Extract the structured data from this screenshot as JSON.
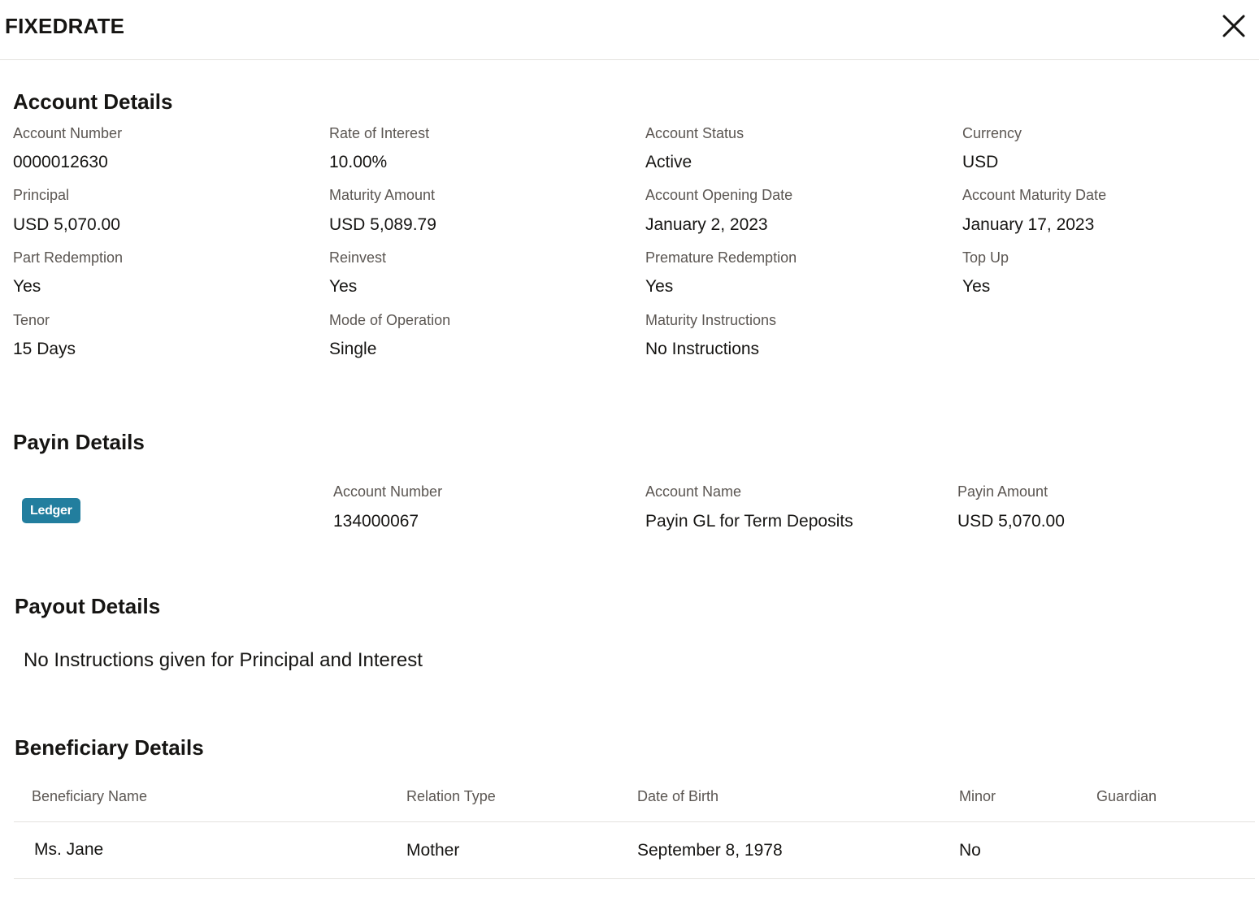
{
  "dialog": {
    "title": "FIXEDRATE"
  },
  "icons": {
    "close": "close-icon"
  },
  "account_details": {
    "title": "Account Details",
    "fields": [
      {
        "label": "Account Number",
        "value": "0000012630"
      },
      {
        "label": "Rate of Interest",
        "value": "10.00%"
      },
      {
        "label": "Account Status",
        "value": "Active"
      },
      {
        "label": "Currency",
        "value": "USD"
      },
      {
        "label": "Principal",
        "value": "USD 5,070.00"
      },
      {
        "label": "Maturity Amount",
        "value": "USD 5,089.79"
      },
      {
        "label": "Account Opening Date",
        "value": "January 2, 2023"
      },
      {
        "label": "Account Maturity Date",
        "value": "January 17, 2023"
      },
      {
        "label": "Part Redemption",
        "value": "Yes"
      },
      {
        "label": "Reinvest",
        "value": "Yes"
      },
      {
        "label": "Premature Redemption",
        "value": "Yes"
      },
      {
        "label": "Top Up",
        "value": "Yes"
      },
      {
        "label": "Tenor",
        "value": "15 Days"
      },
      {
        "label": "Mode of Operation",
        "value": "Single"
      },
      {
        "label": "Maturity Instructions",
        "value": "No Instructions"
      }
    ]
  },
  "payin_details": {
    "title": "Payin Details",
    "badge": "Ledger",
    "badge_color": "#227e9e",
    "fields": [
      {
        "label": "Account Number",
        "value": "134000067"
      },
      {
        "label": "Account Name",
        "value": "Payin GL for Term Deposits"
      },
      {
        "label": "Payin Amount",
        "value": "USD 5,070.00"
      }
    ]
  },
  "payout_details": {
    "title": "Payout Details",
    "message": "No Instructions given for Principal and Interest"
  },
  "beneficiary_details": {
    "title": "Beneficiary Details",
    "columns": [
      "Beneficiary Name",
      "Relation Type",
      "Date of Birth",
      "Minor",
      "Guardian"
    ],
    "rows": [
      [
        "Ms. Jane",
        "Mother",
        "September 8, 1978",
        "No",
        ""
      ]
    ]
  }
}
